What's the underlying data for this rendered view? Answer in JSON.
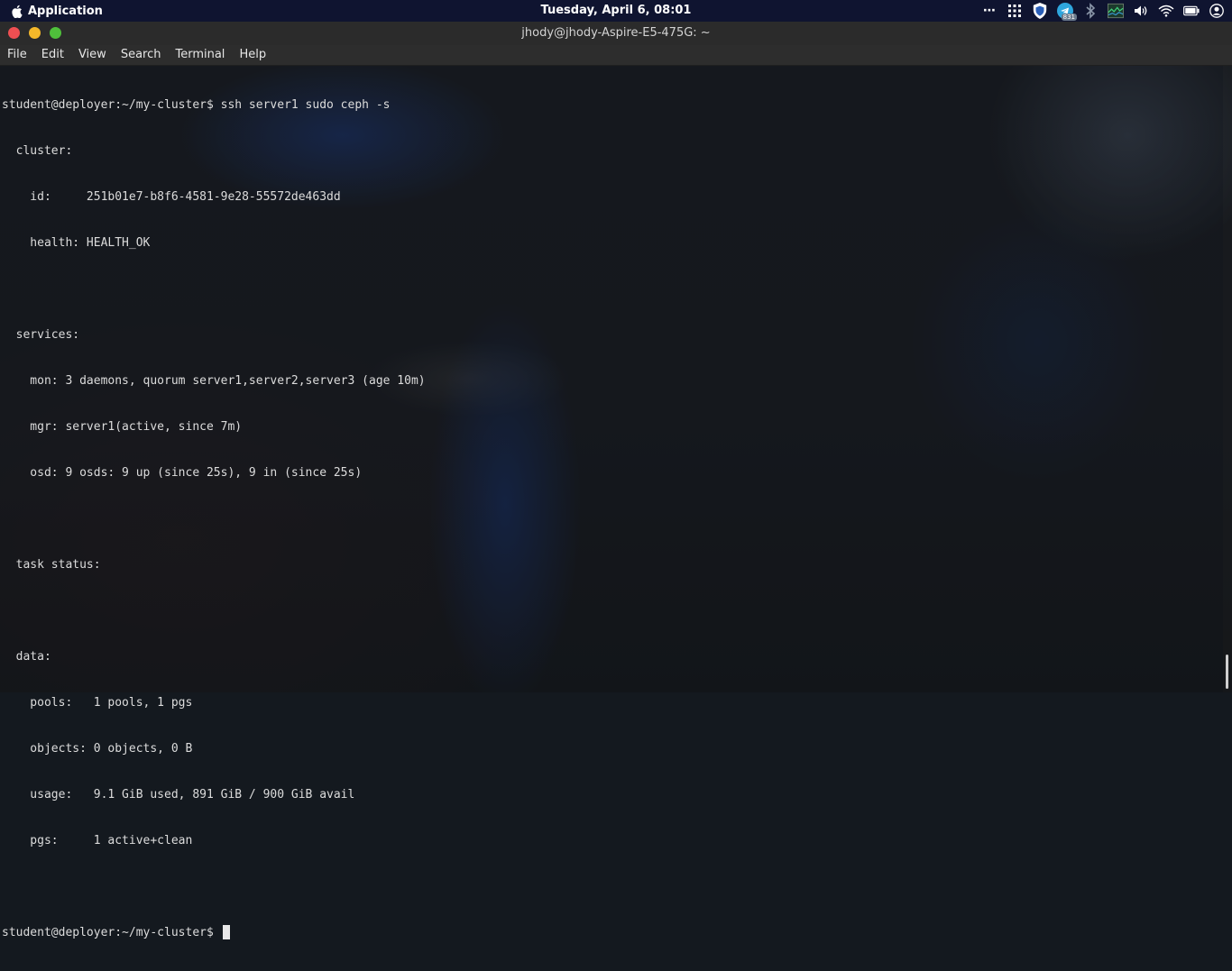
{
  "topbar": {
    "app_label": "Application",
    "clock": "Tuesday, April  6, 08:01",
    "tray": {
      "more": "⋯",
      "badge_count": "831"
    }
  },
  "window": {
    "title": "jhody@jhody-Aspire-E5-475G: ~"
  },
  "menu": {
    "items": [
      "File",
      "Edit",
      "View",
      "Search",
      "Terminal",
      "Help"
    ]
  },
  "terminal": {
    "lines": [
      "student@deployer:~/my-cluster$ ssh server1 sudo ceph -s",
      "  cluster:",
      "    id:     251b01e7-b8f6-4581-9e28-55572de463dd",
      "    health: HEALTH_OK",
      "",
      "  services:",
      "    mon: 3 daemons, quorum server1,server2,server3 (age 10m)",
      "    mgr: server1(active, since 7m)",
      "    osd: 9 osds: 9 up (since 25s), 9 in (since 25s)",
      "",
      "  task status:",
      "",
      "  data:",
      "    pools:   1 pools, 1 pgs",
      "    objects: 0 objects, 0 B",
      "    usage:   9.1 GiB used, 891 GiB / 900 GiB avail",
      "    pgs:     1 active+clean",
      "",
      "student@deployer:~/my-cluster$ "
    ]
  },
  "colors": {
    "topbar": "#0e1432",
    "titlebar": "#2b2b2b",
    "close": "#ef4f52",
    "minimize": "#f5b82a",
    "maximize": "#4fc03b",
    "terminal_text": "#dcdcdc"
  }
}
